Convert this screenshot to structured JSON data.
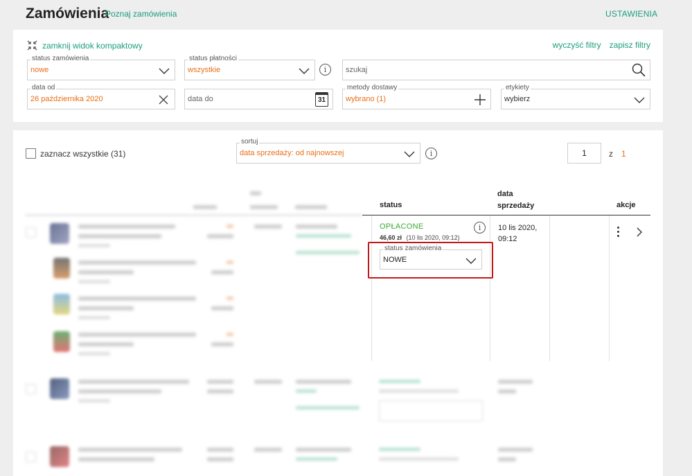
{
  "header": {
    "title": "Zamówienia",
    "learn_link": "Poznaj zamówienia",
    "settings_link": "USTAWIENIA"
  },
  "filters": {
    "compact_toggle": "zamknij widok kompaktowy",
    "clear_filters": "wyczyść filtry",
    "save_filters": "zapisz filtry",
    "order_status": {
      "label": "status zamówienia",
      "value": "nowe"
    },
    "payment_status": {
      "label": "status płatności",
      "value": "wszystkie"
    },
    "search": {
      "placeholder": "szukaj"
    },
    "date_from": {
      "label": "data od",
      "value": "26 października 2020"
    },
    "date_to": {
      "placeholder": "data do",
      "calendar_day": "31"
    },
    "delivery": {
      "label": "metody dostawy",
      "value": "wybrano (1)"
    },
    "labels": {
      "label": "etykiety",
      "value": "wybierz"
    }
  },
  "list": {
    "select_all": "zaznacz wszystkie (31)",
    "sort": {
      "label": "sortuj",
      "value": "data sprzedaży: od najnowszej"
    },
    "pagination": {
      "current": "1",
      "of_label": "z",
      "total": "1"
    },
    "columns": {
      "status": "status",
      "sale_date_line1": "data",
      "sale_date_line2": "sprzedaży",
      "actions": "akcje"
    },
    "order": {
      "status": "OPŁACONE",
      "amount": "46,60 zł",
      "paid_at": "(10 lis 2020, 09:12)",
      "order_status_label": "status zamówienia",
      "order_status_value": "NOWE",
      "sale_date_line1": "10 lis 2020,",
      "sale_date_line2": "09:12"
    }
  },
  "colors": {
    "accent": "#1a9e7a",
    "value_orange": "#e76f18",
    "paid_green": "#3aaa35",
    "highlight_red": "#c41818"
  }
}
